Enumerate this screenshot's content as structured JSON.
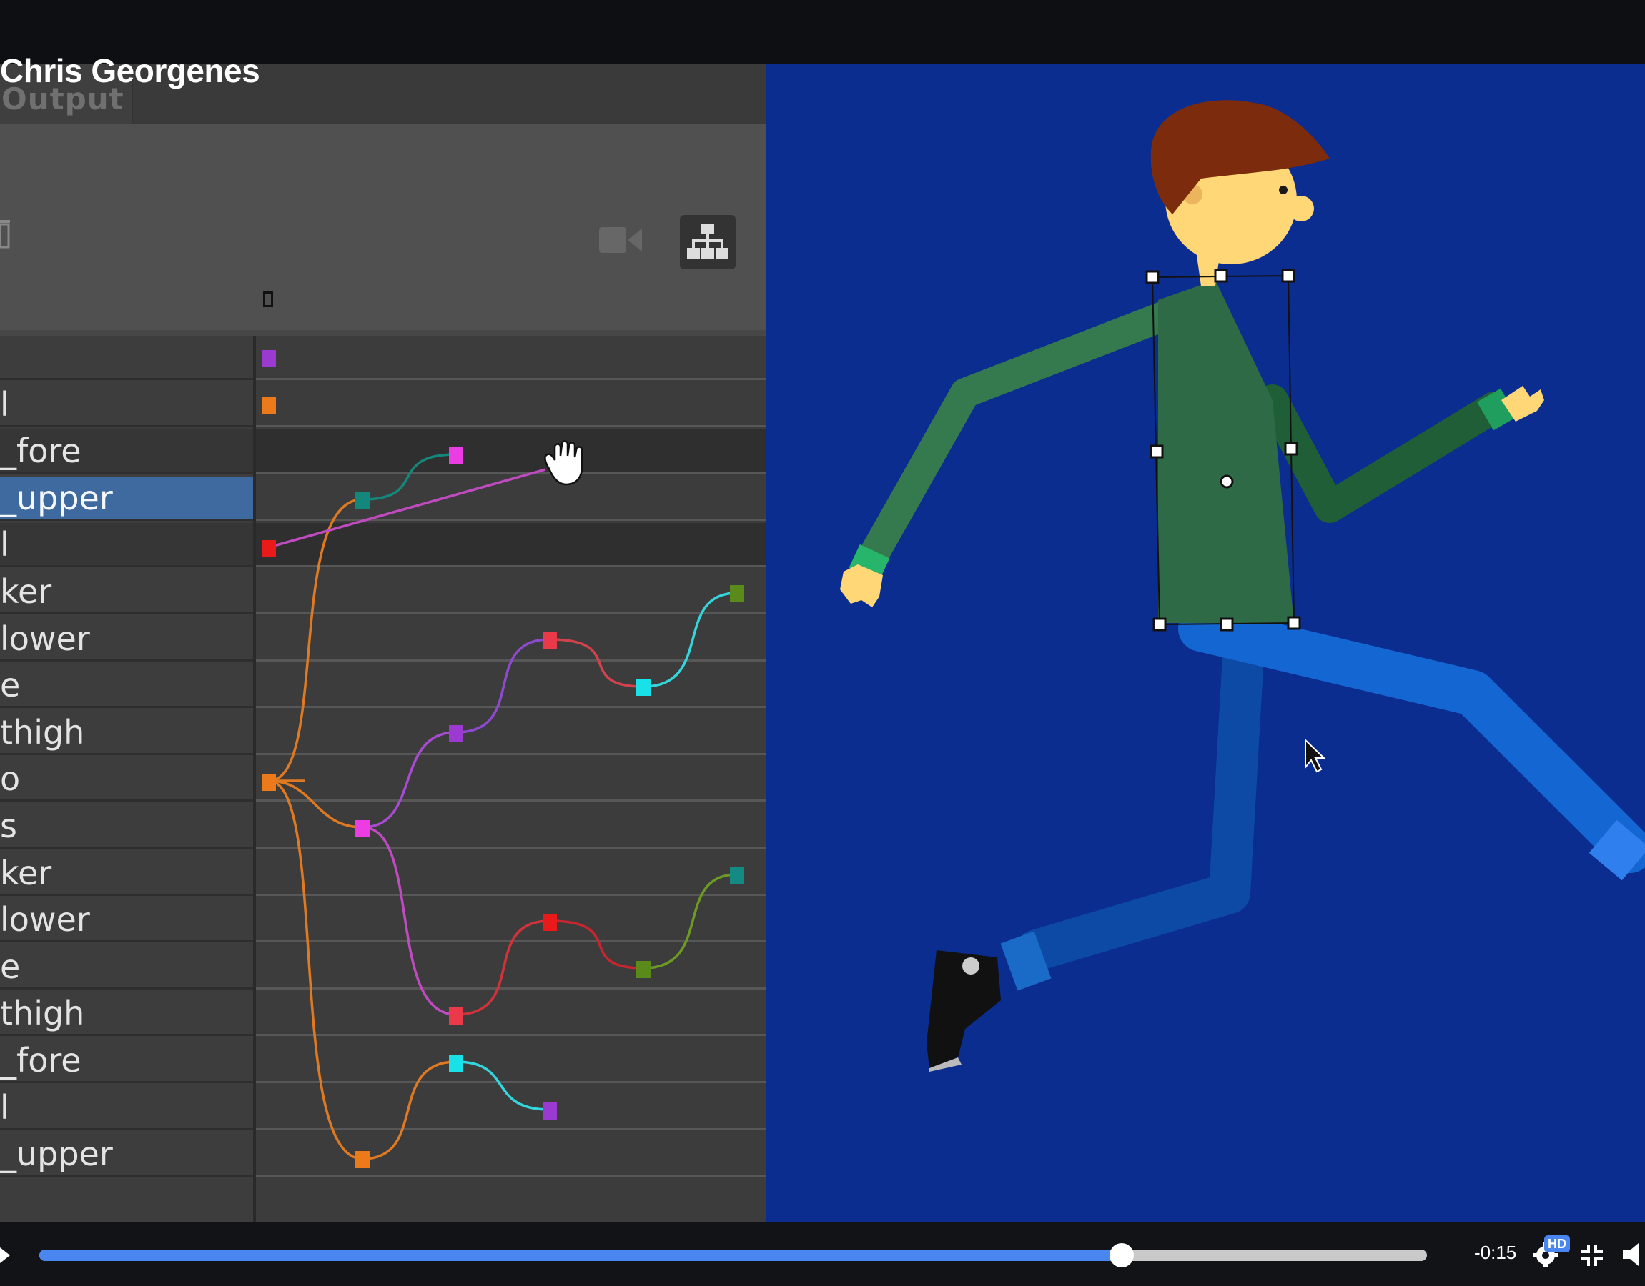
{
  "video": {
    "title": "Chris Georgenes",
    "time_remaining": "-0:15",
    "progress_fraction": 0.78,
    "hd_label": "HD"
  },
  "panel": {
    "tab_label": "Output",
    "layers": [
      {
        "label": ""
      },
      {
        "label": "l"
      },
      {
        "label": "_fore"
      },
      {
        "label": "_upper"
      },
      {
        "label": "l"
      },
      {
        "label": "ker"
      },
      {
        "label": "lower"
      },
      {
        "label": "e"
      },
      {
        "label": "thigh"
      },
      {
        "label": "o"
      },
      {
        "label": "s"
      },
      {
        "label": "ker"
      },
      {
        "label": "lower"
      },
      {
        "label": "e"
      },
      {
        "label": "thigh"
      },
      {
        "label": "_fore"
      },
      {
        "label": "l"
      },
      {
        "label": "_upper"
      }
    ],
    "selected_layer_index": 3
  },
  "colors": {
    "stage_background": "#0a2d8f",
    "panel_background": "#474747",
    "selection": "#3f6a9f",
    "progress": "#4a86f0"
  },
  "icons": [
    "trash-icon",
    "camera-icon",
    "hierarchy-icon",
    "hand-cursor-icon",
    "arrow-cursor-icon",
    "play-icon",
    "gear-icon",
    "minimize-icon",
    "volume-icon"
  ]
}
